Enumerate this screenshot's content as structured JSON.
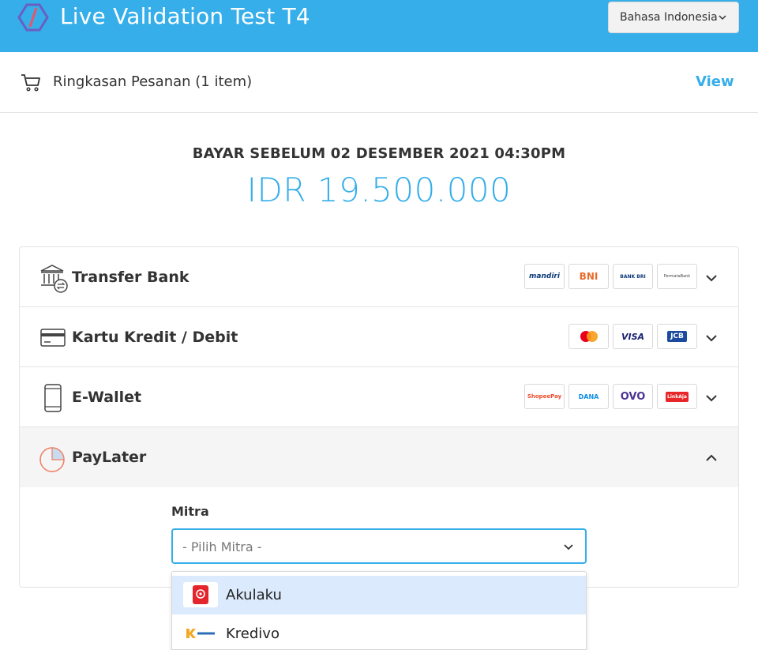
{
  "header": {
    "title": "Live Validation Test T4",
    "language": "Bahasa Indonesia",
    "colors": {
      "brand": "#35aee9",
      "header_text": "#ffffff"
    }
  },
  "summary": {
    "label": "Ringkasan Pesanan (1 item)",
    "view_label": "View"
  },
  "payment": {
    "deadline": "BAYAR SEBELUM 02 DESEMBER 2021 04:30PM",
    "amount": "IDR 19.500.000"
  },
  "methods": [
    {
      "label": "Transfer Bank",
      "icon": "bank-transfer-icon",
      "badges": [
        "mandiri",
        "BNI",
        "BANK BRI",
        "PermataBank"
      ],
      "expanded": false
    },
    {
      "label": "Kartu Kredit / Debit",
      "icon": "credit-card-icon",
      "badges": [
        "Mastercard",
        "VISA",
        "JCB"
      ],
      "expanded": false
    },
    {
      "label": "E-Wallet",
      "icon": "phone-icon",
      "badges": [
        "ShopeePay",
        "DANA",
        "OVO",
        "LinkAja"
      ],
      "expanded": false
    },
    {
      "label": "PayLater",
      "icon": "pie-chart-icon",
      "badges": [],
      "expanded": true
    }
  ],
  "paylater": {
    "mitra_label": "Mitra",
    "mitra_placeholder": "- Pilih Mitra -",
    "options": [
      {
        "label": "Akulaku",
        "highlighted": true
      },
      {
        "label": "Kredivo",
        "highlighted": false
      }
    ]
  }
}
